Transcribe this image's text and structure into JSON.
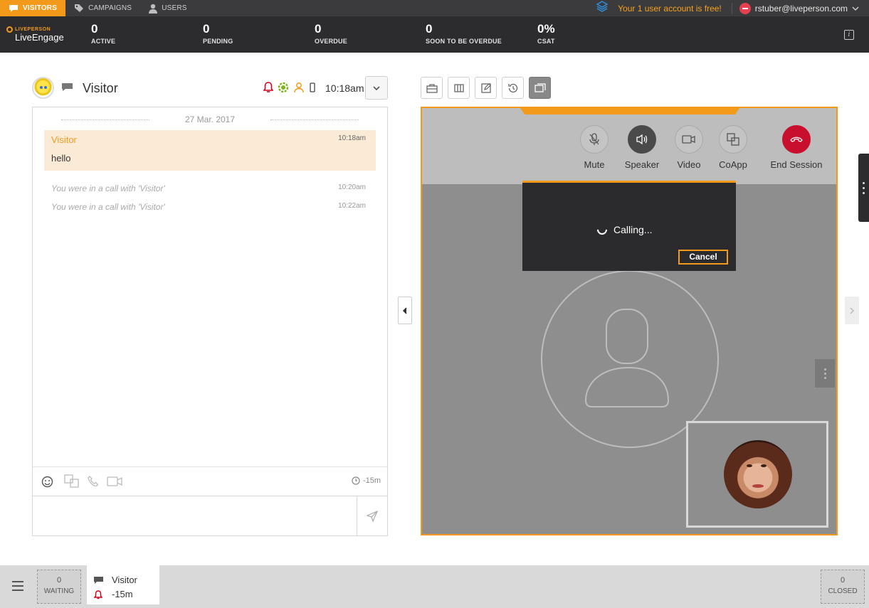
{
  "topnav": {
    "items": [
      {
        "label": "VISITORS",
        "icon": "chat-bubble-icon",
        "active": true
      },
      {
        "label": "CAMPAIGNS",
        "icon": "tag-icon",
        "active": false
      },
      {
        "label": "USERS",
        "icon": "user-icon",
        "active": false
      }
    ],
    "free_msg": "Your 1 user account is free!",
    "user_email": "rstuber@liveperson.com"
  },
  "brand": {
    "small": "LIVEPERSON",
    "big": "LiveEngage"
  },
  "kpis": [
    {
      "value": "0",
      "label": "ACTIVE"
    },
    {
      "value": "0",
      "label": "PENDING"
    },
    {
      "value": "0",
      "label": "OVERDUE"
    },
    {
      "value": "0",
      "label": "SOON TO BE OVERDUE"
    },
    {
      "value": "0%",
      "label": "CSAT"
    }
  ],
  "conversation": {
    "title": "Visitor",
    "time": "10:18am",
    "date": "27 Mar. 2017",
    "message": {
      "who": "Visitor",
      "time": "10:18am",
      "text": "hello"
    },
    "system": [
      {
        "text": "You were in a call with 'Visitor'",
        "time": "10:20am"
      },
      {
        "text": "You were in a call with 'Visitor'",
        "time": "10:22am"
      }
    ],
    "timer": "-15m",
    "compose_placeholder": ""
  },
  "video": {
    "controls": [
      {
        "label": "Mute",
        "icon": "mic-muted-icon"
      },
      {
        "label": "Speaker",
        "icon": "speaker-icon"
      },
      {
        "label": "Video",
        "icon": "video-camera-icon"
      },
      {
        "label": "CoApp",
        "icon": "coapp-icon"
      },
      {
        "label": "End Session",
        "icon": "hangup-icon"
      }
    ],
    "dialog_text": "Calling...",
    "cancel_label": "Cancel"
  },
  "bottombar": {
    "waiting": {
      "count": "0",
      "label": "WAITING"
    },
    "closed": {
      "count": "0",
      "label": "CLOSED"
    },
    "tab": {
      "name": "Visitor",
      "time": "-15m"
    }
  },
  "colors": {
    "accent": "#f39a1b",
    "dark": "#2c2c2e",
    "alert": "#c8102e"
  }
}
